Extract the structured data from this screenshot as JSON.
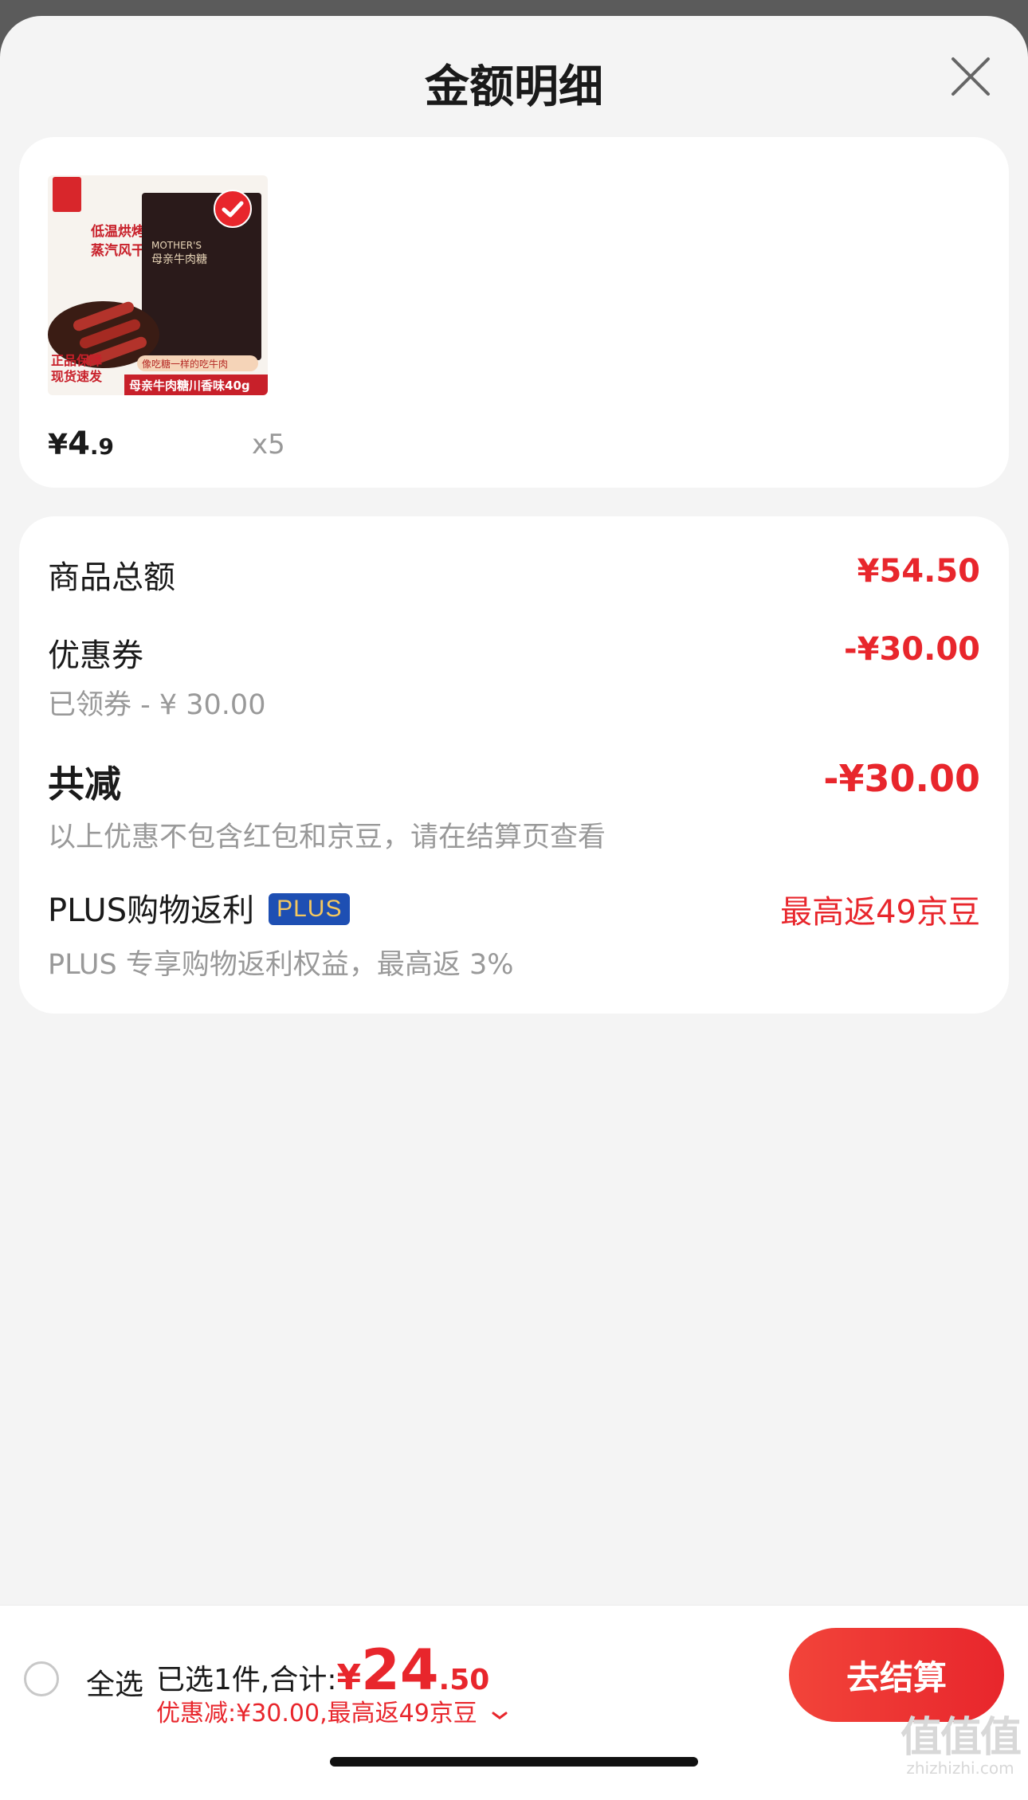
{
  "header": {
    "title": "金额明细"
  },
  "product": {
    "price_yen": "¥",
    "price_int": "4",
    "price_dec": ".9",
    "qty": "x5",
    "image_text": {
      "headline_1": "低温烘烤",
      "headline_2": "蒸汽风干",
      "brand_en": "MOTHER'S",
      "brand_cn": "母亲牛肉糖",
      "slogan": "像吃糖一样的吃牛肉",
      "badge_1": "正品保障",
      "badge_2": "现货速发",
      "bottom": "母亲牛肉糖川香味40g"
    }
  },
  "details": {
    "goods_total_label": "商品总额",
    "goods_total_value": "¥54.50",
    "coupon_label": "优惠券",
    "coupon_value": "-¥30.00",
    "coupon_sub": "已领券 - ¥ 30.00",
    "reduce_label": "共减",
    "reduce_value": "-¥30.00",
    "reduce_sub": "以上优惠不包含红包和京豆，请在结算页查看",
    "plus_label": "PLUS购物返利",
    "plus_badge": "PLUS",
    "plus_value": "最高返49京豆",
    "plus_sub": "PLUS 专享购物返利权益，最高返 3%"
  },
  "bottom": {
    "select_all": "全选",
    "summary_prefix": "已选1件,合计:",
    "total_yen": "¥",
    "total_int": "24",
    "total_dec": ".50",
    "discount_line": "优惠减:¥30.00,最高返49京豆",
    "checkout": "去结算"
  },
  "watermark": {
    "mark": "值值值",
    "text": "zhizhizhi.com"
  },
  "colors": {
    "accent": "#e8262c",
    "plus_badge_bg": "#1e4fb3",
    "plus_badge_text": "#f5c85e"
  }
}
